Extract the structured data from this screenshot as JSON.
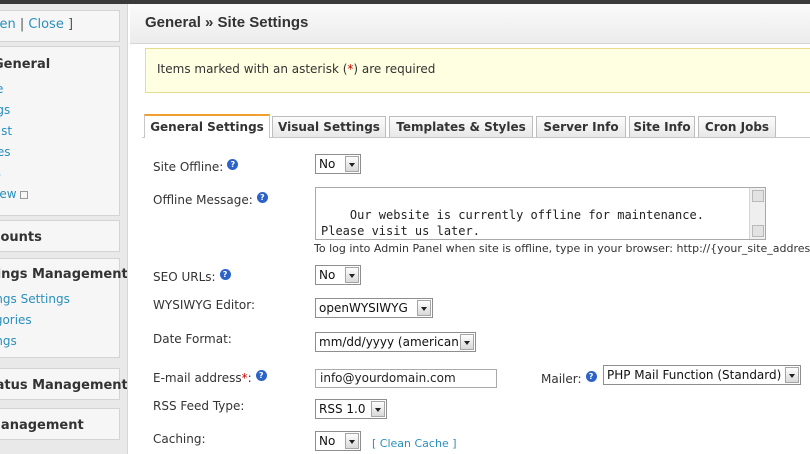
{
  "sidebar": {
    "toggle": {
      "open": "Open",
      "sep": "|",
      "close": "Close",
      "end": "]"
    },
    "general_head": "General",
    "general_items": [
      "Home",
      "Settings",
      "Admin List",
      "Countries",
      "Statistics",
      "Site Preview"
    ],
    "accounts_head": "Accounts",
    "listings_head": "Listings Management",
    "listings_items": [
      "Listings Settings",
      "Categories",
      "Listings"
    ],
    "status_head": "Status Management",
    "management_head": "Management"
  },
  "header": {
    "title": "General » Site Settings"
  },
  "notice": {
    "before": "Items marked with an asterisk (",
    "asterisk": "*",
    "after": ") are required"
  },
  "tabs": [
    "General Settings",
    "Visual Settings",
    "Templates & Styles",
    "Server Info",
    "Site Info",
    "Cron Jobs"
  ],
  "form": {
    "site_offline_label": "Site Offline:",
    "site_offline_value": "No",
    "offline_message_label": "Offline Message:",
    "offline_message_value": "Our website is currently offline for maintenance.\nPlease visit us later.",
    "offline_hint": "To log into Admin Panel when site is offline, type in your browser: http://{your_site_address}",
    "seo_label": "SEO URLs:",
    "seo_value": "No",
    "wysiwyg_label": "WYSIWYG Editor:",
    "wysiwyg_value": "openWYSIWYG",
    "date_label": "Date Format:",
    "date_value": "mm/dd/yyyy (american)",
    "email_label": "E-mail address",
    "email_req": "*",
    "email_colon": ":",
    "email_value": "info@yourdomain.com",
    "mailer_label": "Mailer:",
    "mailer_value": "PHP Mail Function (Standard)",
    "rss_label": "RSS Feed Type:",
    "rss_value": "RSS 1.0",
    "caching_label": "Caching:",
    "caching_value": "No",
    "clean_cache": "[ Clean Cache ]",
    "help_glyph": "?"
  },
  "colors": {
    "accent": "#f0a030",
    "link": "#2a8fbd",
    "help": "#2d63c8",
    "required": "#cc0000",
    "notice_bg": "#ffffe1"
  }
}
